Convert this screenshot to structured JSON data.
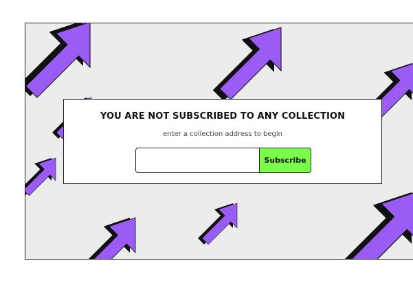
{
  "panel": {
    "title": "YOU ARE NOT SUBSCRIBED TO ANY COLLECTION",
    "subtitle": "enter a collection address to begin"
  },
  "form": {
    "input_value": "",
    "input_placeholder": "",
    "button_label": "Subscribe"
  },
  "background": {
    "pattern_icon": "arrow-cursor-icon",
    "arrow_color": "#9b5cf5",
    "shadow_color": "#111111",
    "stage_color": "#ececec"
  },
  "colors": {
    "accent": "#7cff4a"
  }
}
